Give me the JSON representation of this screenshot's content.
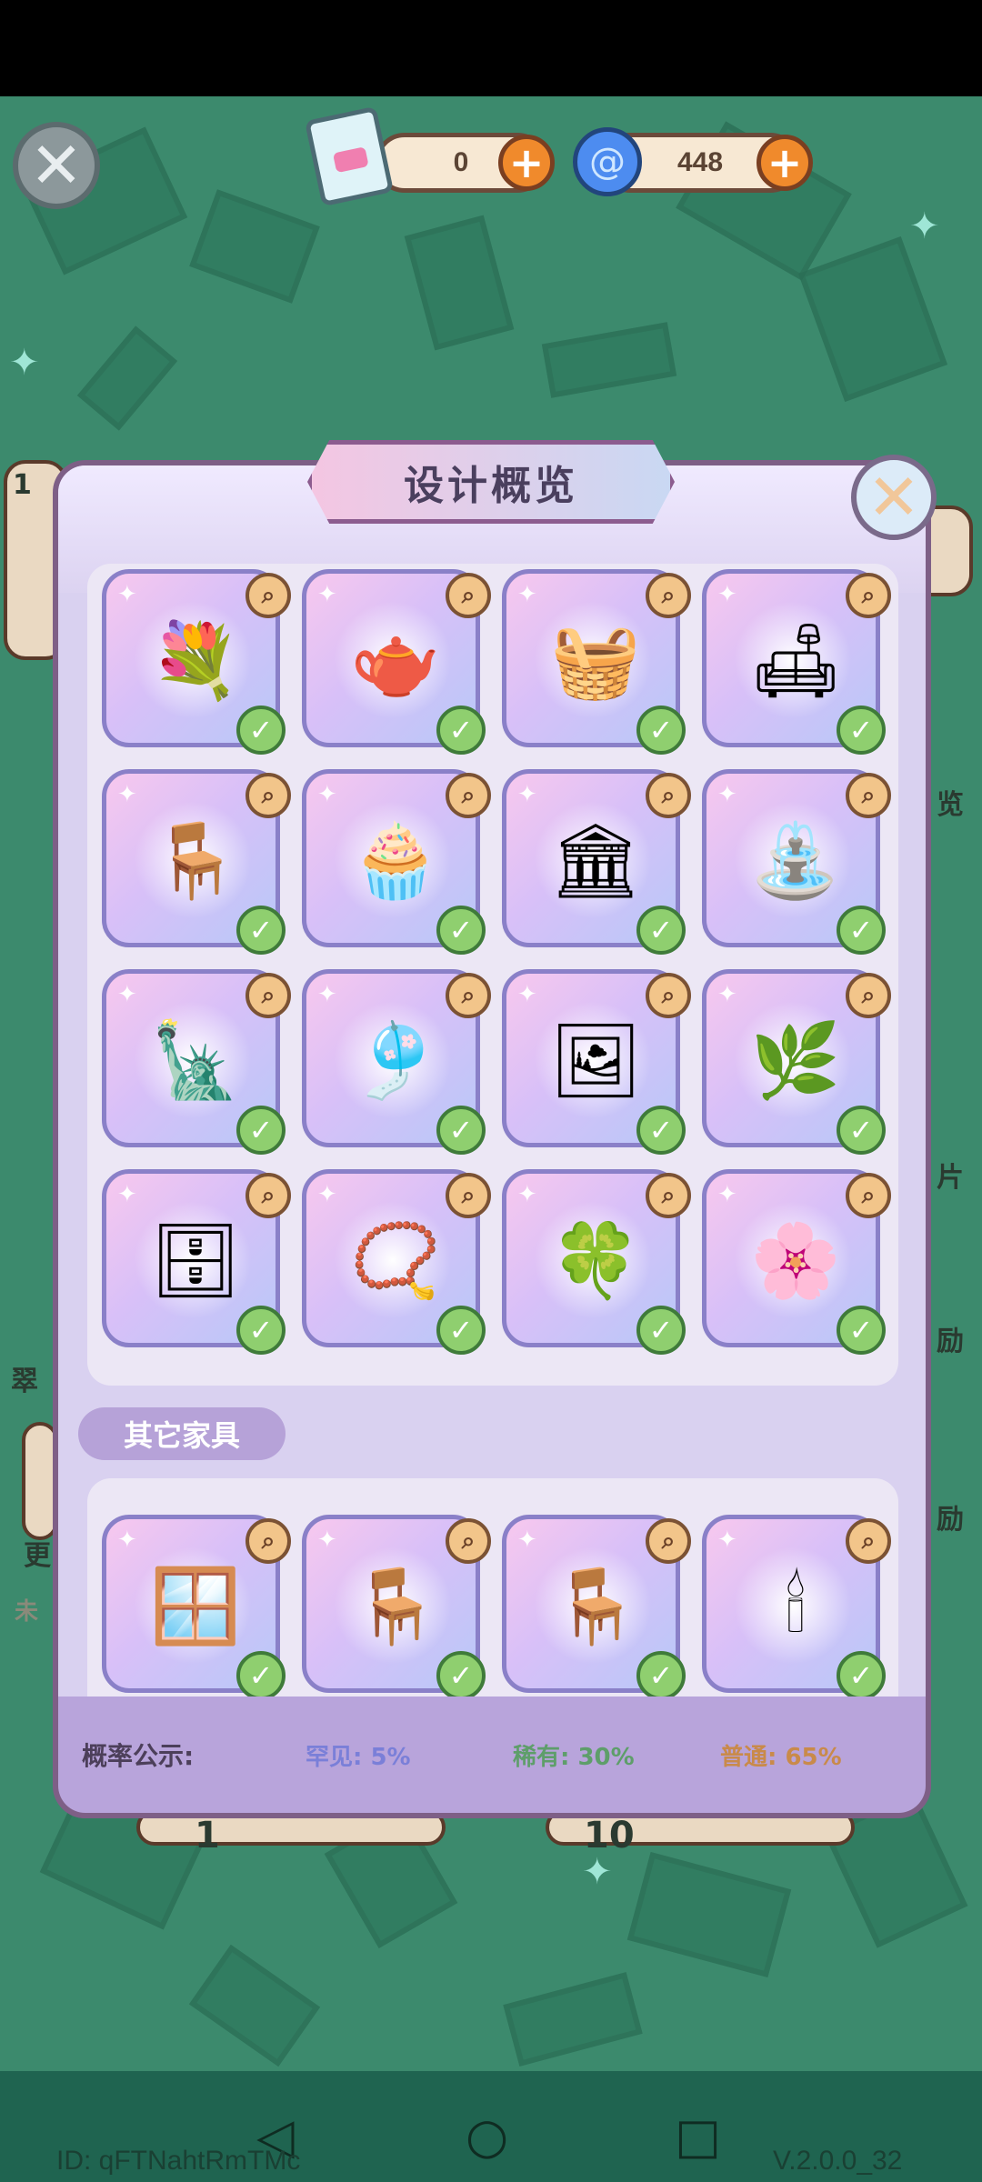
{
  "header": {
    "ticket_count": "0",
    "swirl_count": "448"
  },
  "panel": {
    "title": "设计概览",
    "section_other_furniture": "其它家具"
  },
  "items": [
    {
      "icon": "flower-vase-icon",
      "glyph": "💐",
      "owned": true
    },
    {
      "icon": "watering-can-icon",
      "glyph": "🫖",
      "owned": true
    },
    {
      "icon": "sheet-cloth-icon",
      "glyph": "🧺",
      "owned": true
    },
    {
      "icon": "sofa-icon",
      "glyph": "🛋",
      "owned": true
    },
    {
      "icon": "round-stool-icon",
      "glyph": "🪑",
      "owned": true
    },
    {
      "icon": "lace-table-icon",
      "glyph": "🧁",
      "owned": true
    },
    {
      "icon": "balustrade-icon",
      "glyph": "🏛",
      "owned": true
    },
    {
      "icon": "birdbath-fountain-icon",
      "glyph": "⛲",
      "owned": true
    },
    {
      "icon": "statue-icon",
      "glyph": "🗽",
      "owned": true
    },
    {
      "icon": "curtain-icon",
      "glyph": "🎐",
      "owned": true
    },
    {
      "icon": "easel-icon",
      "glyph": "🖼",
      "owned": true
    },
    {
      "icon": "vine-arch-icon",
      "glyph": "🌿",
      "owned": true
    },
    {
      "icon": "wooden-shelf-icon",
      "glyph": "🗄",
      "owned": true
    },
    {
      "icon": "bead-string-icon",
      "glyph": "📿",
      "owned": true
    },
    {
      "icon": "hanging-vines-icon",
      "glyph": "🍀",
      "owned": true
    },
    {
      "icon": "rose-vine-icon",
      "glyph": "🌸",
      "owned": true
    }
  ],
  "other_items": [
    {
      "icon": "folding-screen-icon",
      "glyph": "🪟",
      "owned": true
    },
    {
      "icon": "flower-chair-icon",
      "glyph": "🪑",
      "owned": true
    },
    {
      "icon": "draped-chair-icon",
      "glyph": "🪑",
      "owned": true
    },
    {
      "icon": "wall-sconce-icon",
      "glyph": "🕯",
      "owned": true
    }
  ],
  "footer": {
    "label": "概率公示:",
    "rare": "罕见: 5%",
    "uncommon": "稀有: 30%",
    "common": "普通: 65%",
    "colors": {
      "rare": "#7a7fd8",
      "uncommon": "#5e9e6a",
      "common": "#c98a4a"
    }
  },
  "bottom": {
    "id_text": "ID: qFTNahtRmTMc",
    "version": "V.2.0.0_32"
  },
  "behind_labels": {
    "left_1": "翠",
    "left_2": "更",
    "left_3": "未",
    "right_1": "览",
    "right_2": "片",
    "right_3": "励",
    "right_4": "励",
    "left_badge": "1",
    "bottom_left_num": "1",
    "bottom_right_num": "10"
  }
}
